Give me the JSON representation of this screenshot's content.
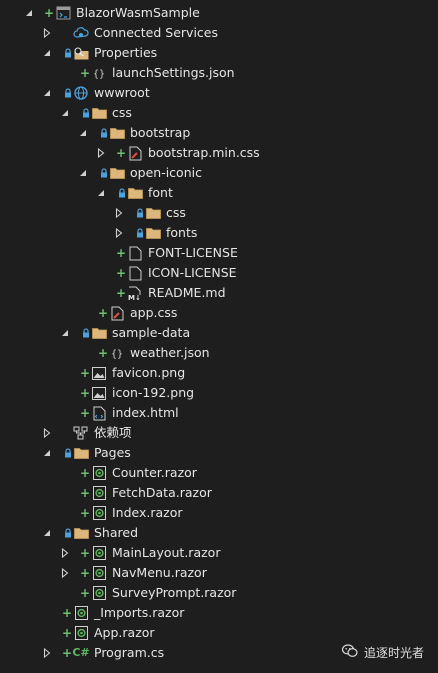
{
  "tree": [
    {
      "label": "BlazorWasmSample",
      "depth": 0,
      "expander": "expanded",
      "plus": true,
      "lock": false,
      "icon": "solution-icon"
    },
    {
      "label": "Connected Services",
      "depth": 1,
      "expander": "collapsed",
      "plus": false,
      "lock": false,
      "icon": "connected-services-icon"
    },
    {
      "label": "Properties",
      "depth": 1,
      "expander": "expanded",
      "plus": false,
      "lock": true,
      "icon": "properties-folder-icon"
    },
    {
      "label": "launchSettings.json",
      "depth": 2,
      "expander": "none",
      "plus": true,
      "lock": false,
      "icon": "json-file-icon"
    },
    {
      "label": "wwwroot",
      "depth": 1,
      "expander": "expanded",
      "plus": false,
      "lock": true,
      "icon": "globe-icon"
    },
    {
      "label": "css",
      "depth": 2,
      "expander": "expanded",
      "plus": false,
      "lock": true,
      "icon": "folder-icon"
    },
    {
      "label": "bootstrap",
      "depth": 3,
      "expander": "expanded",
      "plus": false,
      "lock": true,
      "icon": "folder-icon"
    },
    {
      "label": "bootstrap.min.css",
      "depth": 4,
      "expander": "collapsed",
      "plus": true,
      "lock": false,
      "icon": "css-file-icon"
    },
    {
      "label": "open-iconic",
      "depth": 3,
      "expander": "expanded",
      "plus": false,
      "lock": true,
      "icon": "folder-icon"
    },
    {
      "label": "font",
      "depth": 4,
      "expander": "expanded",
      "plus": false,
      "lock": true,
      "icon": "folder-icon"
    },
    {
      "label": "css",
      "depth": 5,
      "expander": "collapsed",
      "plus": false,
      "lock": true,
      "icon": "folder-icon"
    },
    {
      "label": "fonts",
      "depth": 5,
      "expander": "collapsed",
      "plus": false,
      "lock": true,
      "icon": "folder-icon"
    },
    {
      "label": "FONT-LICENSE",
      "depth": 4,
      "expander": "none",
      "plus": true,
      "lock": false,
      "icon": "text-file-icon"
    },
    {
      "label": "ICON-LICENSE",
      "depth": 4,
      "expander": "none",
      "plus": true,
      "lock": false,
      "icon": "text-file-icon"
    },
    {
      "label": "README.md",
      "depth": 4,
      "expander": "none",
      "plus": true,
      "lock": false,
      "icon": "markdown-file-icon"
    },
    {
      "label": "app.css",
      "depth": 3,
      "expander": "none",
      "plus": true,
      "lock": false,
      "icon": "css-file-icon"
    },
    {
      "label": "sample-data",
      "depth": 2,
      "expander": "expanded",
      "plus": false,
      "lock": true,
      "icon": "folder-icon"
    },
    {
      "label": "weather.json",
      "depth": 3,
      "expander": "none",
      "plus": true,
      "lock": false,
      "icon": "json-file-icon"
    },
    {
      "label": "favicon.png",
      "depth": 2,
      "expander": "none",
      "plus": true,
      "lock": false,
      "icon": "image-file-icon"
    },
    {
      "label": "icon-192.png",
      "depth": 2,
      "expander": "none",
      "plus": true,
      "lock": false,
      "icon": "image-file-icon"
    },
    {
      "label": "index.html",
      "depth": 2,
      "expander": "none",
      "plus": true,
      "lock": false,
      "icon": "html-file-icon"
    },
    {
      "label": "依赖项",
      "depth": 1,
      "expander": "collapsed",
      "plus": false,
      "lock": false,
      "icon": "dependencies-icon"
    },
    {
      "label": "Pages",
      "depth": 1,
      "expander": "expanded",
      "plus": false,
      "lock": true,
      "icon": "folder-icon"
    },
    {
      "label": "Counter.razor",
      "depth": 2,
      "expander": "none",
      "plus": true,
      "lock": false,
      "icon": "razor-file-icon"
    },
    {
      "label": "FetchData.razor",
      "depth": 2,
      "expander": "none",
      "plus": true,
      "lock": false,
      "icon": "razor-file-icon"
    },
    {
      "label": "Index.razor",
      "depth": 2,
      "expander": "none",
      "plus": true,
      "lock": false,
      "icon": "razor-file-icon"
    },
    {
      "label": "Shared",
      "depth": 1,
      "expander": "expanded",
      "plus": false,
      "lock": true,
      "icon": "folder-icon"
    },
    {
      "label": "MainLayout.razor",
      "depth": 2,
      "expander": "collapsed",
      "plus": true,
      "lock": false,
      "icon": "razor-file-icon"
    },
    {
      "label": "NavMenu.razor",
      "depth": 2,
      "expander": "collapsed",
      "plus": true,
      "lock": false,
      "icon": "razor-file-icon"
    },
    {
      "label": "SurveyPrompt.razor",
      "depth": 2,
      "expander": "none",
      "plus": true,
      "lock": false,
      "icon": "razor-file-icon"
    },
    {
      "label": "_Imports.razor",
      "depth": 1,
      "expander": "none",
      "plus": true,
      "lock": false,
      "icon": "razor-file-icon"
    },
    {
      "label": "App.razor",
      "depth": 1,
      "expander": "none",
      "plus": true,
      "lock": false,
      "icon": "razor-file-icon"
    },
    {
      "label": "Program.cs",
      "depth": 1,
      "expander": "collapsed",
      "plus": true,
      "lock": false,
      "icon": "csharp-file-icon"
    }
  ],
  "icons": {
    "csharp_glyph": "C#",
    "markdown_glyph": "M↓"
  },
  "colors": {
    "background": "#1e1e1e",
    "text": "#e6e6e6",
    "folder": "#dcb67a",
    "lock": "#4aa3df",
    "plus": "#6fbf73",
    "razor": "#5fb85f"
  },
  "watermark": {
    "text": "追逐时光者",
    "icon": "wechat-icon"
  }
}
